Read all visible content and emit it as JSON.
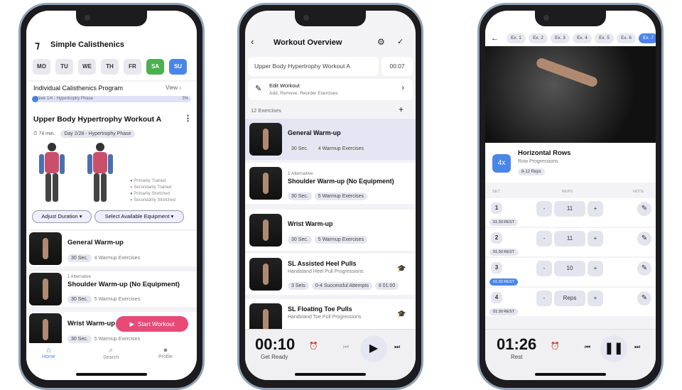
{
  "colors": {
    "accent": "#4a86e8",
    "saturday": "#4caf50",
    "start": "#e84a78",
    "highlight": "#e4e4f2"
  },
  "home": {
    "app_title": "Simple Calisthenics",
    "days": [
      "MO",
      "TU",
      "WE",
      "TH",
      "FR",
      "SA",
      "SU"
    ],
    "program": {
      "title": "Individual Calisthenics Program",
      "view": "View",
      "week": "Week 1/4 - Hypertrophy Phase",
      "percent": "3%",
      "progress": 3
    },
    "workout": {
      "title": "Upper Body Hypertrophy Workout A",
      "duration": "74 min.",
      "day": "Day 2/28 - Hypertrophy Phase"
    },
    "legend": [
      "Primarily Trained",
      "Secondarily Trained",
      "Primarily Stretched",
      "Secondarily Stretched"
    ],
    "adjust": "Adjust Duration",
    "equipment": "Select Available Equipment",
    "items": [
      {
        "alt": "",
        "title": "General Warm-up",
        "time": "30 Sec.",
        "desc": "4 Warmup Exercises"
      },
      {
        "alt": "1 Alternative",
        "title": "Shoulder Warm-up (No Equipment)",
        "time": "30 Sec.",
        "desc": "5 Warmup Exercises"
      },
      {
        "alt": "",
        "title": "Wrist Warm-up",
        "time": "30 Sec.",
        "desc": "5 Warmup Exercises"
      }
    ],
    "start": "Start Workout",
    "nav": [
      "Home",
      "Search",
      "Profile"
    ]
  },
  "overview": {
    "title": "Workout Overview",
    "name": "Upper Body Hypertrophy Workout A",
    "timer": "00:07",
    "edit_title": "Edit Workout",
    "edit_sub": "Add, Remove, Reorder Exercises",
    "count": "12 Exercises",
    "items": [
      {
        "alt": "",
        "title": "General Warm-up",
        "sub": "",
        "tags": [
          "30 Sec.",
          "4 Warmup Exercises"
        ]
      },
      {
        "alt": "1 Alternative",
        "title": "Shoulder Warm-up (No Equipment)",
        "sub": "",
        "tags": [
          "30 Sec.",
          "5 Warmup Exercises"
        ]
      },
      {
        "alt": "",
        "title": "Wrist Warm-up",
        "sub": "",
        "tags": [
          "30 Sec.",
          "5 Warmup Exercises"
        ]
      },
      {
        "alt": "",
        "title": "SL Assisted Heel Pulls",
        "sub": "Handstand Heel Pull Progressions",
        "tags": [
          "3 Sets",
          "0-4 Successful Attempts",
          "II 01:00"
        ]
      },
      {
        "alt": "",
        "title": "SL Floating Toe Pulls",
        "sub": "Handstand Toe Pull Progressions",
        "tags": []
      }
    ],
    "player": {
      "time": "00:10",
      "label": "Get Ready"
    }
  },
  "session": {
    "tabs": [
      "Ex. 1",
      "Ex. 2",
      "Ex. 3",
      "Ex. 4",
      "Ex. 5",
      "Ex. 6",
      "Ex. 7"
    ],
    "sets_badge": "4x",
    "title": "Horizontal Rows",
    "sub": "Row Progressions",
    "reps_range": "8-12 Reps",
    "headers": [
      "SET",
      "REPS",
      "NOTE"
    ],
    "sets": [
      {
        "n": "1",
        "reps": "11",
        "rest": "01:30 REST"
      },
      {
        "n": "2",
        "reps": "11",
        "rest": "01:30 REST"
      },
      {
        "n": "3",
        "reps": "10",
        "rest": "01:30 REST",
        "active": true
      },
      {
        "n": "4",
        "reps": "Reps",
        "rest": "01:30 REST"
      }
    ],
    "minus": "-",
    "plus": "+",
    "player": {
      "time": "01:26",
      "label": "Rest"
    }
  }
}
